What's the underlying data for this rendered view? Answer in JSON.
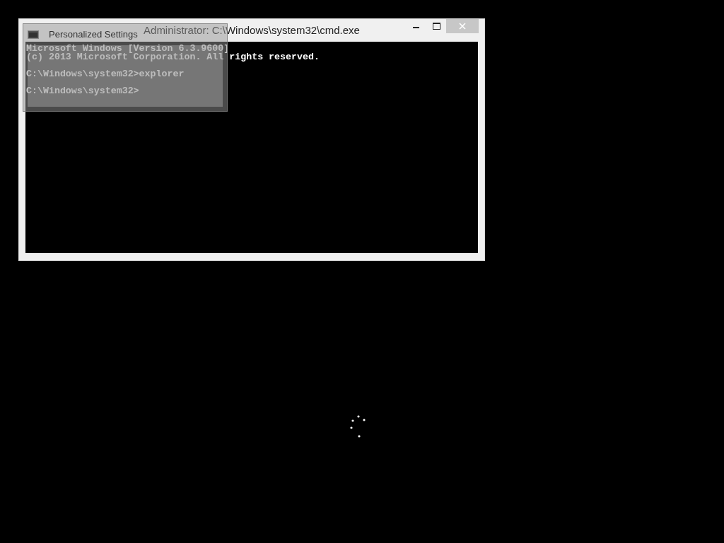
{
  "cmd_window": {
    "title": "Administrator: C:\\Windows\\system32\\cmd.exe",
    "lines": [
      {
        "text": "Microsoft Windows [Version 6.3.9600]",
        "blank_before": false
      },
      {
        "text": "(c) 2013 Microsoft Corporation. All rights reserved.",
        "blank_before": false
      },
      {
        "text": "C:\\Windows\\system32>explorer",
        "blank_before": true
      },
      {
        "text": "C:\\Windows\\system32>",
        "blank_before": true
      }
    ]
  },
  "overlay_window": {
    "title": "Personalized Settings"
  }
}
